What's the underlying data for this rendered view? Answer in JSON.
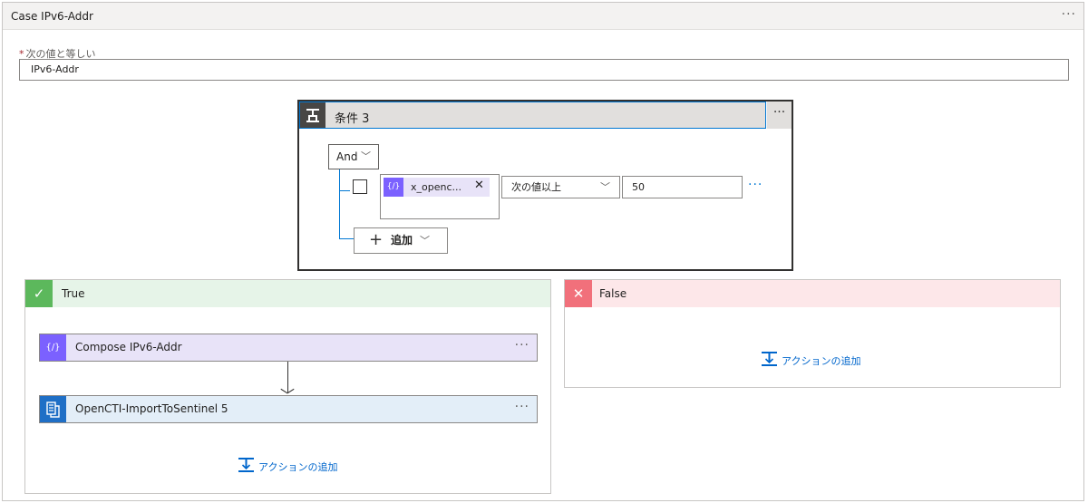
{
  "case": {
    "title": "Case IPv6-Addr",
    "more": "···",
    "equals_required": "*",
    "equals_label": "次の値と等しい",
    "equals_value": "IPv6-Addr"
  },
  "condition": {
    "title": "条件 3",
    "more": "···",
    "group_operator": "And",
    "row": {
      "token_label": "x_openc...",
      "token_close": "✕",
      "operator": "次の値以上",
      "value": "50",
      "more": "···"
    },
    "add_label": "追加"
  },
  "true_branch": {
    "label": "True",
    "actions": [
      {
        "label": "Compose IPv6-Addr",
        "more": "···"
      },
      {
        "label": "OpenCTI-ImportToSentinel 5",
        "more": "···"
      }
    ],
    "add_action": "アクションの追加"
  },
  "false_branch": {
    "label": "False",
    "add_action": "アクションの追加"
  },
  "colors": {
    "accent": "#0078d4",
    "true": "#5cb85c",
    "false": "#f1707b",
    "compose": "#7b61ff",
    "workflow": "#1f6fc6"
  }
}
